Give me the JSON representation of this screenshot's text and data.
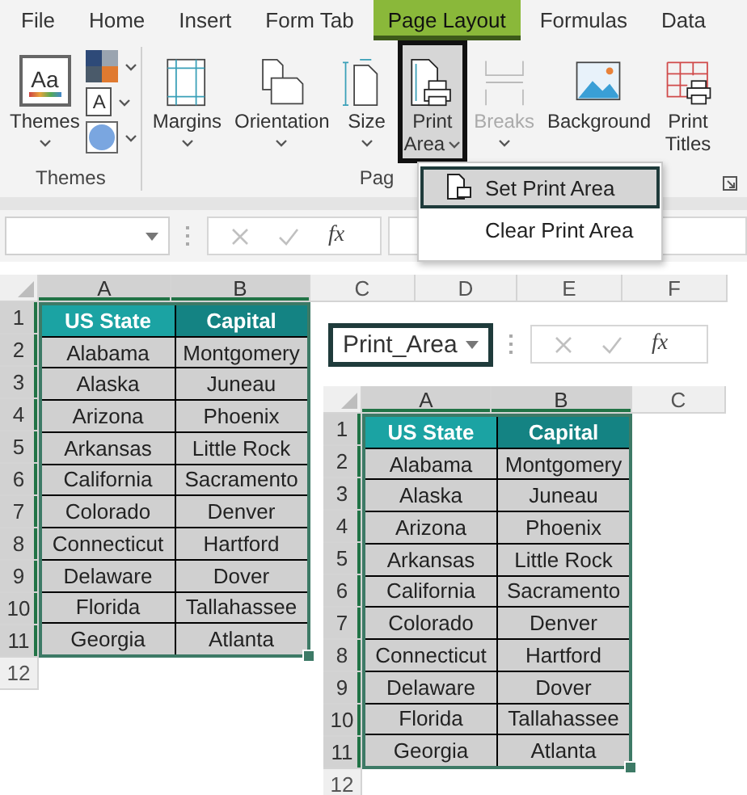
{
  "ribbon_tabs": [
    {
      "label": "File",
      "selected": false
    },
    {
      "label": "Home",
      "selected": false
    },
    {
      "label": "Insert",
      "selected": false
    },
    {
      "label": "Form Tab",
      "selected": false
    },
    {
      "label": "Page Layout",
      "selected": true
    },
    {
      "label": "Formulas",
      "selected": false
    },
    {
      "label": "Data",
      "selected": false
    }
  ],
  "ribbon": {
    "groups": [
      {
        "label": "Themes",
        "buttons": [
          {
            "kind": "themes",
            "label": "Themes",
            "icon_text": "Aa",
            "dropdown": true
          }
        ],
        "small_buttons": [
          {
            "kind": "colors"
          },
          {
            "kind": "fonts",
            "label": "A"
          },
          {
            "kind": "effects"
          }
        ]
      },
      {
        "label": "Pag",
        "launcher": true,
        "buttons": [
          {
            "kind": "margins",
            "label": "Margins",
            "dropdown": true
          },
          {
            "kind": "orientation",
            "label": "Orientation",
            "dropdown": true
          },
          {
            "kind": "size",
            "label": "Size",
            "dropdown": true
          },
          {
            "kind": "print_area",
            "label": "Print Area",
            "dropdown": true,
            "highlighted": true
          },
          {
            "kind": "breaks",
            "label": "Breaks",
            "dropdown": true,
            "disabled": true
          },
          {
            "kind": "background",
            "label": "Background"
          },
          {
            "kind": "print_titles",
            "label": "Print Titles"
          }
        ]
      }
    ]
  },
  "print_area_menu": {
    "items": [
      {
        "label": "Set Print Area",
        "selected": true
      },
      {
        "label": "Clear Print Area",
        "selected": false
      }
    ]
  },
  "formula_bar": {
    "function_label": "fx"
  },
  "sheet": {
    "columns": [
      {
        "label": "A",
        "selected": true
      },
      {
        "label": "B",
        "selected": true
      },
      {
        "label": "C",
        "selected": false
      },
      {
        "label": "D",
        "selected": false
      },
      {
        "label": "E",
        "selected": false
      },
      {
        "label": "F",
        "selected": false
      }
    ],
    "row_headers": [
      {
        "label": "1",
        "selected": true
      },
      {
        "label": "2",
        "selected": true
      },
      {
        "label": "3",
        "selected": true
      },
      {
        "label": "4",
        "selected": true
      },
      {
        "label": "5",
        "selected": true
      },
      {
        "label": "6",
        "selected": true
      },
      {
        "label": "7",
        "selected": true
      },
      {
        "label": "8",
        "selected": true
      },
      {
        "label": "9",
        "selected": true
      },
      {
        "label": "10",
        "selected": true
      },
      {
        "label": "11",
        "selected": true
      },
      {
        "label": "12",
        "selected": false
      }
    ],
    "table": {
      "headers": [
        {
          "label": "US State",
          "color": "#1ba3a3"
        },
        {
          "label": "Capital",
          "color": "#148383"
        }
      ],
      "rows": [
        [
          "Alabama",
          "Montgomery"
        ],
        [
          "Alaska",
          "Juneau"
        ],
        [
          "Arizona",
          "Phoenix"
        ],
        [
          "Arkansas",
          "Little Rock"
        ],
        [
          "California",
          "Sacramento"
        ],
        [
          "Colorado",
          "Denver"
        ],
        [
          "Connecticut",
          "Hartford"
        ],
        [
          "Delaware",
          "Dover"
        ],
        [
          "Florida",
          "Tallahassee"
        ],
        [
          "Georgia",
          "Atlanta"
        ]
      ]
    }
  },
  "inset": {
    "formula_bar": {
      "name_box": "Print_Area",
      "function_label": "fx"
    },
    "sheet": {
      "columns": [
        {
          "label": "A",
          "selected": true
        },
        {
          "label": "B",
          "selected": true
        },
        {
          "label": "C",
          "selected": false
        }
      ],
      "row_headers": [
        {
          "label": "1",
          "selected": true
        },
        {
          "label": "2",
          "selected": true
        },
        {
          "label": "3",
          "selected": true
        },
        {
          "label": "4",
          "selected": true
        },
        {
          "label": "5",
          "selected": true
        },
        {
          "label": "6",
          "selected": true
        },
        {
          "label": "7",
          "selected": true
        },
        {
          "label": "8",
          "selected": true
        },
        {
          "label": "9",
          "selected": true
        },
        {
          "label": "10",
          "selected": true
        },
        {
          "label": "11",
          "selected": true
        },
        {
          "label": "12",
          "selected": false
        }
      ],
      "table": {
        "headers": [
          {
            "label": "US State",
            "color": "#1ba3a3"
          },
          {
            "label": "Capital",
            "color": "#148383"
          }
        ],
        "rows": [
          [
            "Alabama",
            "Montgomery"
          ],
          [
            "Alaska",
            "Juneau"
          ],
          [
            "Arizona",
            "Phoenix"
          ],
          [
            "Arkansas",
            "Little Rock"
          ],
          [
            "California",
            "Sacramento"
          ],
          [
            "Colorado",
            "Denver"
          ],
          [
            "Connecticut",
            "Hartford"
          ],
          [
            "Delaware",
            "Dover"
          ],
          [
            "Florida",
            "Tallahassee"
          ],
          [
            "Georgia",
            "Atlanta"
          ]
        ]
      }
    }
  }
}
